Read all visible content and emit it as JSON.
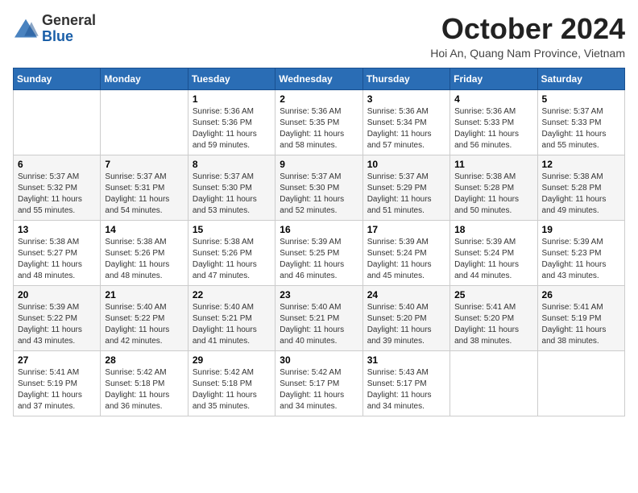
{
  "logo": {
    "general": "General",
    "blue": "Blue"
  },
  "header": {
    "month": "October 2024",
    "location": "Hoi An, Quang Nam Province, Vietnam"
  },
  "weekdays": [
    "Sunday",
    "Monday",
    "Tuesday",
    "Wednesday",
    "Thursday",
    "Friday",
    "Saturday"
  ],
  "weeks": [
    [
      {
        "day": "",
        "sunrise": "",
        "sunset": "",
        "daylight": ""
      },
      {
        "day": "",
        "sunrise": "",
        "sunset": "",
        "daylight": ""
      },
      {
        "day": "1",
        "sunrise": "Sunrise: 5:36 AM",
        "sunset": "Sunset: 5:36 PM",
        "daylight": "Daylight: 11 hours and 59 minutes."
      },
      {
        "day": "2",
        "sunrise": "Sunrise: 5:36 AM",
        "sunset": "Sunset: 5:35 PM",
        "daylight": "Daylight: 11 hours and 58 minutes."
      },
      {
        "day": "3",
        "sunrise": "Sunrise: 5:36 AM",
        "sunset": "Sunset: 5:34 PM",
        "daylight": "Daylight: 11 hours and 57 minutes."
      },
      {
        "day": "4",
        "sunrise": "Sunrise: 5:36 AM",
        "sunset": "Sunset: 5:33 PM",
        "daylight": "Daylight: 11 hours and 56 minutes."
      },
      {
        "day": "5",
        "sunrise": "Sunrise: 5:37 AM",
        "sunset": "Sunset: 5:33 PM",
        "daylight": "Daylight: 11 hours and 55 minutes."
      }
    ],
    [
      {
        "day": "6",
        "sunrise": "Sunrise: 5:37 AM",
        "sunset": "Sunset: 5:32 PM",
        "daylight": "Daylight: 11 hours and 55 minutes."
      },
      {
        "day": "7",
        "sunrise": "Sunrise: 5:37 AM",
        "sunset": "Sunset: 5:31 PM",
        "daylight": "Daylight: 11 hours and 54 minutes."
      },
      {
        "day": "8",
        "sunrise": "Sunrise: 5:37 AM",
        "sunset": "Sunset: 5:30 PM",
        "daylight": "Daylight: 11 hours and 53 minutes."
      },
      {
        "day": "9",
        "sunrise": "Sunrise: 5:37 AM",
        "sunset": "Sunset: 5:30 PM",
        "daylight": "Daylight: 11 hours and 52 minutes."
      },
      {
        "day": "10",
        "sunrise": "Sunrise: 5:37 AM",
        "sunset": "Sunset: 5:29 PM",
        "daylight": "Daylight: 11 hours and 51 minutes."
      },
      {
        "day": "11",
        "sunrise": "Sunrise: 5:38 AM",
        "sunset": "Sunset: 5:28 PM",
        "daylight": "Daylight: 11 hours and 50 minutes."
      },
      {
        "day": "12",
        "sunrise": "Sunrise: 5:38 AM",
        "sunset": "Sunset: 5:28 PM",
        "daylight": "Daylight: 11 hours and 49 minutes."
      }
    ],
    [
      {
        "day": "13",
        "sunrise": "Sunrise: 5:38 AM",
        "sunset": "Sunset: 5:27 PM",
        "daylight": "Daylight: 11 hours and 48 minutes."
      },
      {
        "day": "14",
        "sunrise": "Sunrise: 5:38 AM",
        "sunset": "Sunset: 5:26 PM",
        "daylight": "Daylight: 11 hours and 48 minutes."
      },
      {
        "day": "15",
        "sunrise": "Sunrise: 5:38 AM",
        "sunset": "Sunset: 5:26 PM",
        "daylight": "Daylight: 11 hours and 47 minutes."
      },
      {
        "day": "16",
        "sunrise": "Sunrise: 5:39 AM",
        "sunset": "Sunset: 5:25 PM",
        "daylight": "Daylight: 11 hours and 46 minutes."
      },
      {
        "day": "17",
        "sunrise": "Sunrise: 5:39 AM",
        "sunset": "Sunset: 5:24 PM",
        "daylight": "Daylight: 11 hours and 45 minutes."
      },
      {
        "day": "18",
        "sunrise": "Sunrise: 5:39 AM",
        "sunset": "Sunset: 5:24 PM",
        "daylight": "Daylight: 11 hours and 44 minutes."
      },
      {
        "day": "19",
        "sunrise": "Sunrise: 5:39 AM",
        "sunset": "Sunset: 5:23 PM",
        "daylight": "Daylight: 11 hours and 43 minutes."
      }
    ],
    [
      {
        "day": "20",
        "sunrise": "Sunrise: 5:39 AM",
        "sunset": "Sunset: 5:22 PM",
        "daylight": "Daylight: 11 hours and 43 minutes."
      },
      {
        "day": "21",
        "sunrise": "Sunrise: 5:40 AM",
        "sunset": "Sunset: 5:22 PM",
        "daylight": "Daylight: 11 hours and 42 minutes."
      },
      {
        "day": "22",
        "sunrise": "Sunrise: 5:40 AM",
        "sunset": "Sunset: 5:21 PM",
        "daylight": "Daylight: 11 hours and 41 minutes."
      },
      {
        "day": "23",
        "sunrise": "Sunrise: 5:40 AM",
        "sunset": "Sunset: 5:21 PM",
        "daylight": "Daylight: 11 hours and 40 minutes."
      },
      {
        "day": "24",
        "sunrise": "Sunrise: 5:40 AM",
        "sunset": "Sunset: 5:20 PM",
        "daylight": "Daylight: 11 hours and 39 minutes."
      },
      {
        "day": "25",
        "sunrise": "Sunrise: 5:41 AM",
        "sunset": "Sunset: 5:20 PM",
        "daylight": "Daylight: 11 hours and 38 minutes."
      },
      {
        "day": "26",
        "sunrise": "Sunrise: 5:41 AM",
        "sunset": "Sunset: 5:19 PM",
        "daylight": "Daylight: 11 hours and 38 minutes."
      }
    ],
    [
      {
        "day": "27",
        "sunrise": "Sunrise: 5:41 AM",
        "sunset": "Sunset: 5:19 PM",
        "daylight": "Daylight: 11 hours and 37 minutes."
      },
      {
        "day": "28",
        "sunrise": "Sunrise: 5:42 AM",
        "sunset": "Sunset: 5:18 PM",
        "daylight": "Daylight: 11 hours and 36 minutes."
      },
      {
        "day": "29",
        "sunrise": "Sunrise: 5:42 AM",
        "sunset": "Sunset: 5:18 PM",
        "daylight": "Daylight: 11 hours and 35 minutes."
      },
      {
        "day": "30",
        "sunrise": "Sunrise: 5:42 AM",
        "sunset": "Sunset: 5:17 PM",
        "daylight": "Daylight: 11 hours and 34 minutes."
      },
      {
        "day": "31",
        "sunrise": "Sunrise: 5:43 AM",
        "sunset": "Sunset: 5:17 PM",
        "daylight": "Daylight: 11 hours and 34 minutes."
      },
      {
        "day": "",
        "sunrise": "",
        "sunset": "",
        "daylight": ""
      },
      {
        "day": "",
        "sunrise": "",
        "sunset": "",
        "daylight": ""
      }
    ]
  ]
}
